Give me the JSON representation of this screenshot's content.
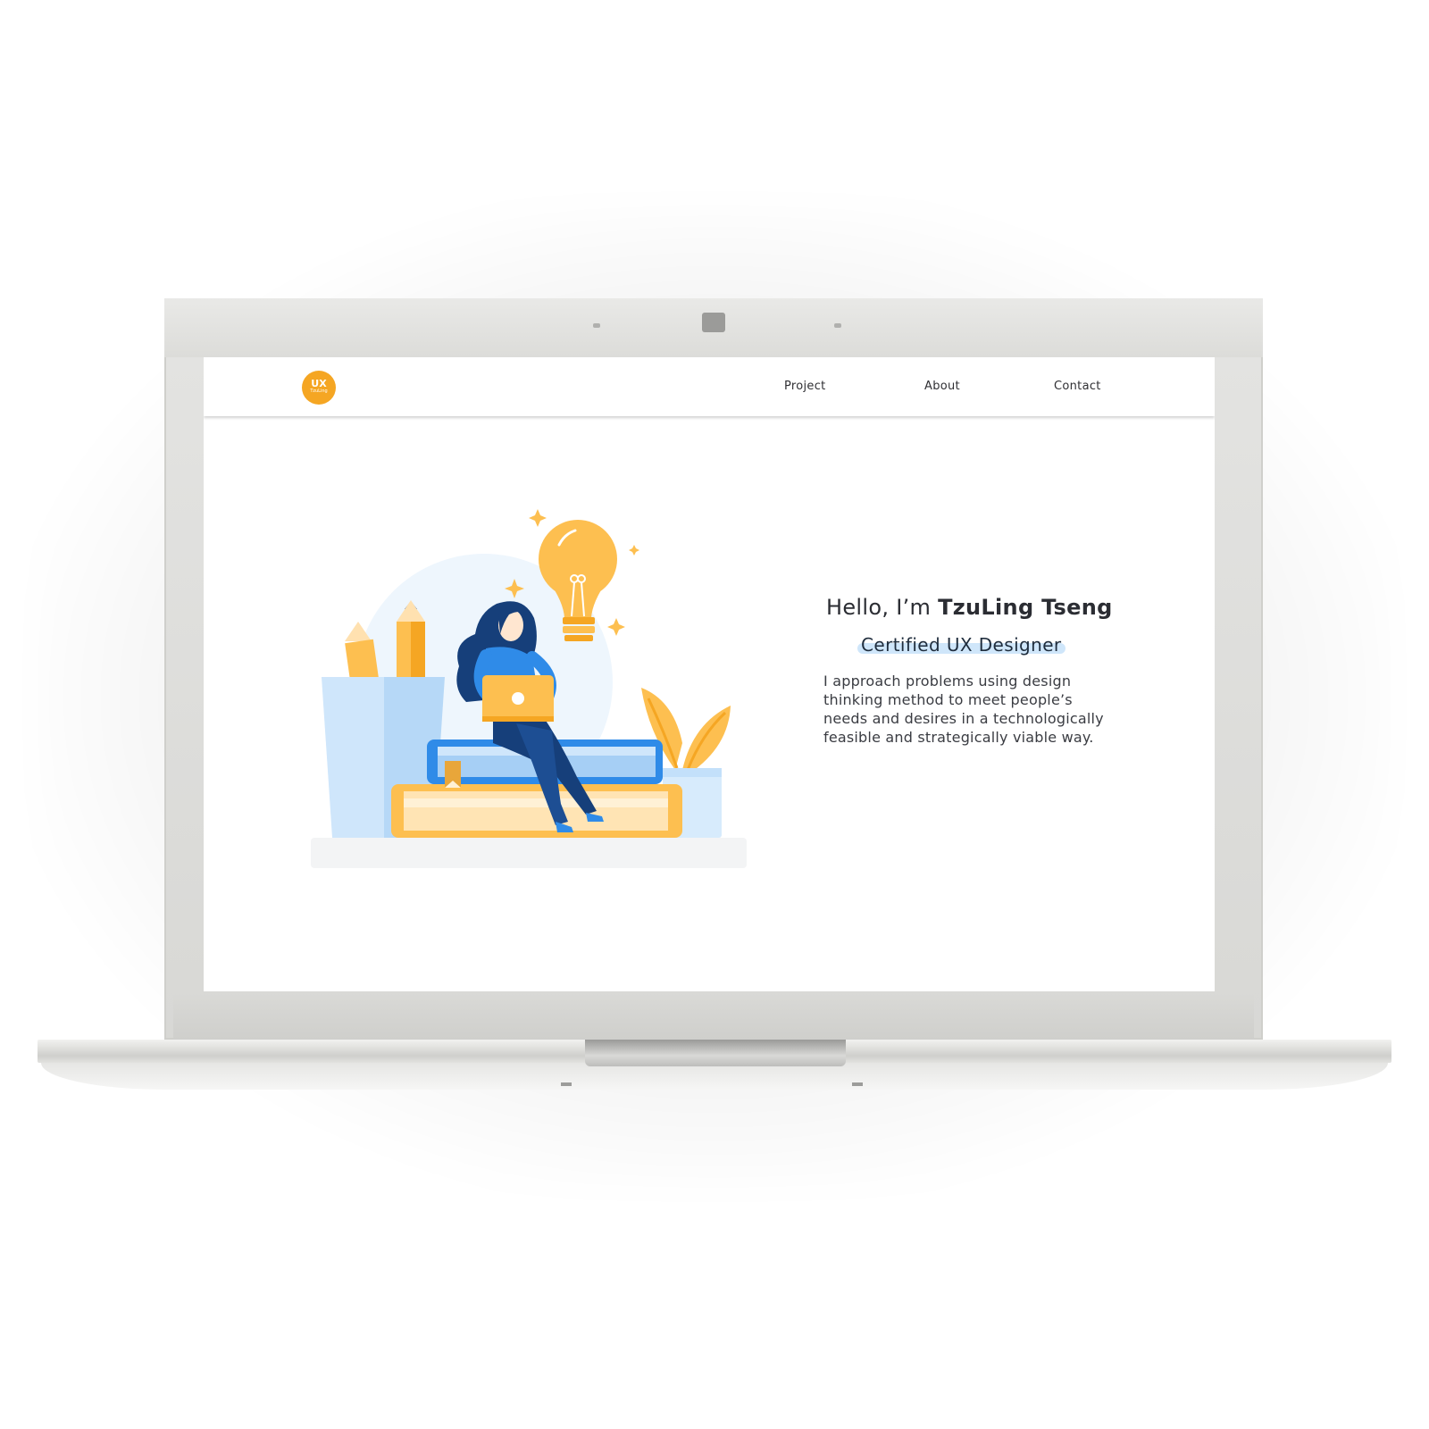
{
  "logo": {
    "main": "UX",
    "sub": "TzuLing"
  },
  "nav": {
    "items": [
      {
        "label": "Project"
      },
      {
        "label": "About"
      },
      {
        "label": "Contact"
      }
    ]
  },
  "hero": {
    "greeting_prefix": "Hello, I’m ",
    "name": "TzuLing Tseng",
    "title": "Certified UX Designer",
    "bio": "I approach problems using design thinking method to meet people’s needs and desires in a technologically feasible and strategically viable way."
  },
  "colors": {
    "accent": "#f5a623",
    "highlight": "#cfe6fa",
    "figure_blue": "#2f8be8",
    "figure_navy": "#163f7a",
    "light_blue": "#cfe6fb",
    "yellow": "#fdbf50"
  }
}
